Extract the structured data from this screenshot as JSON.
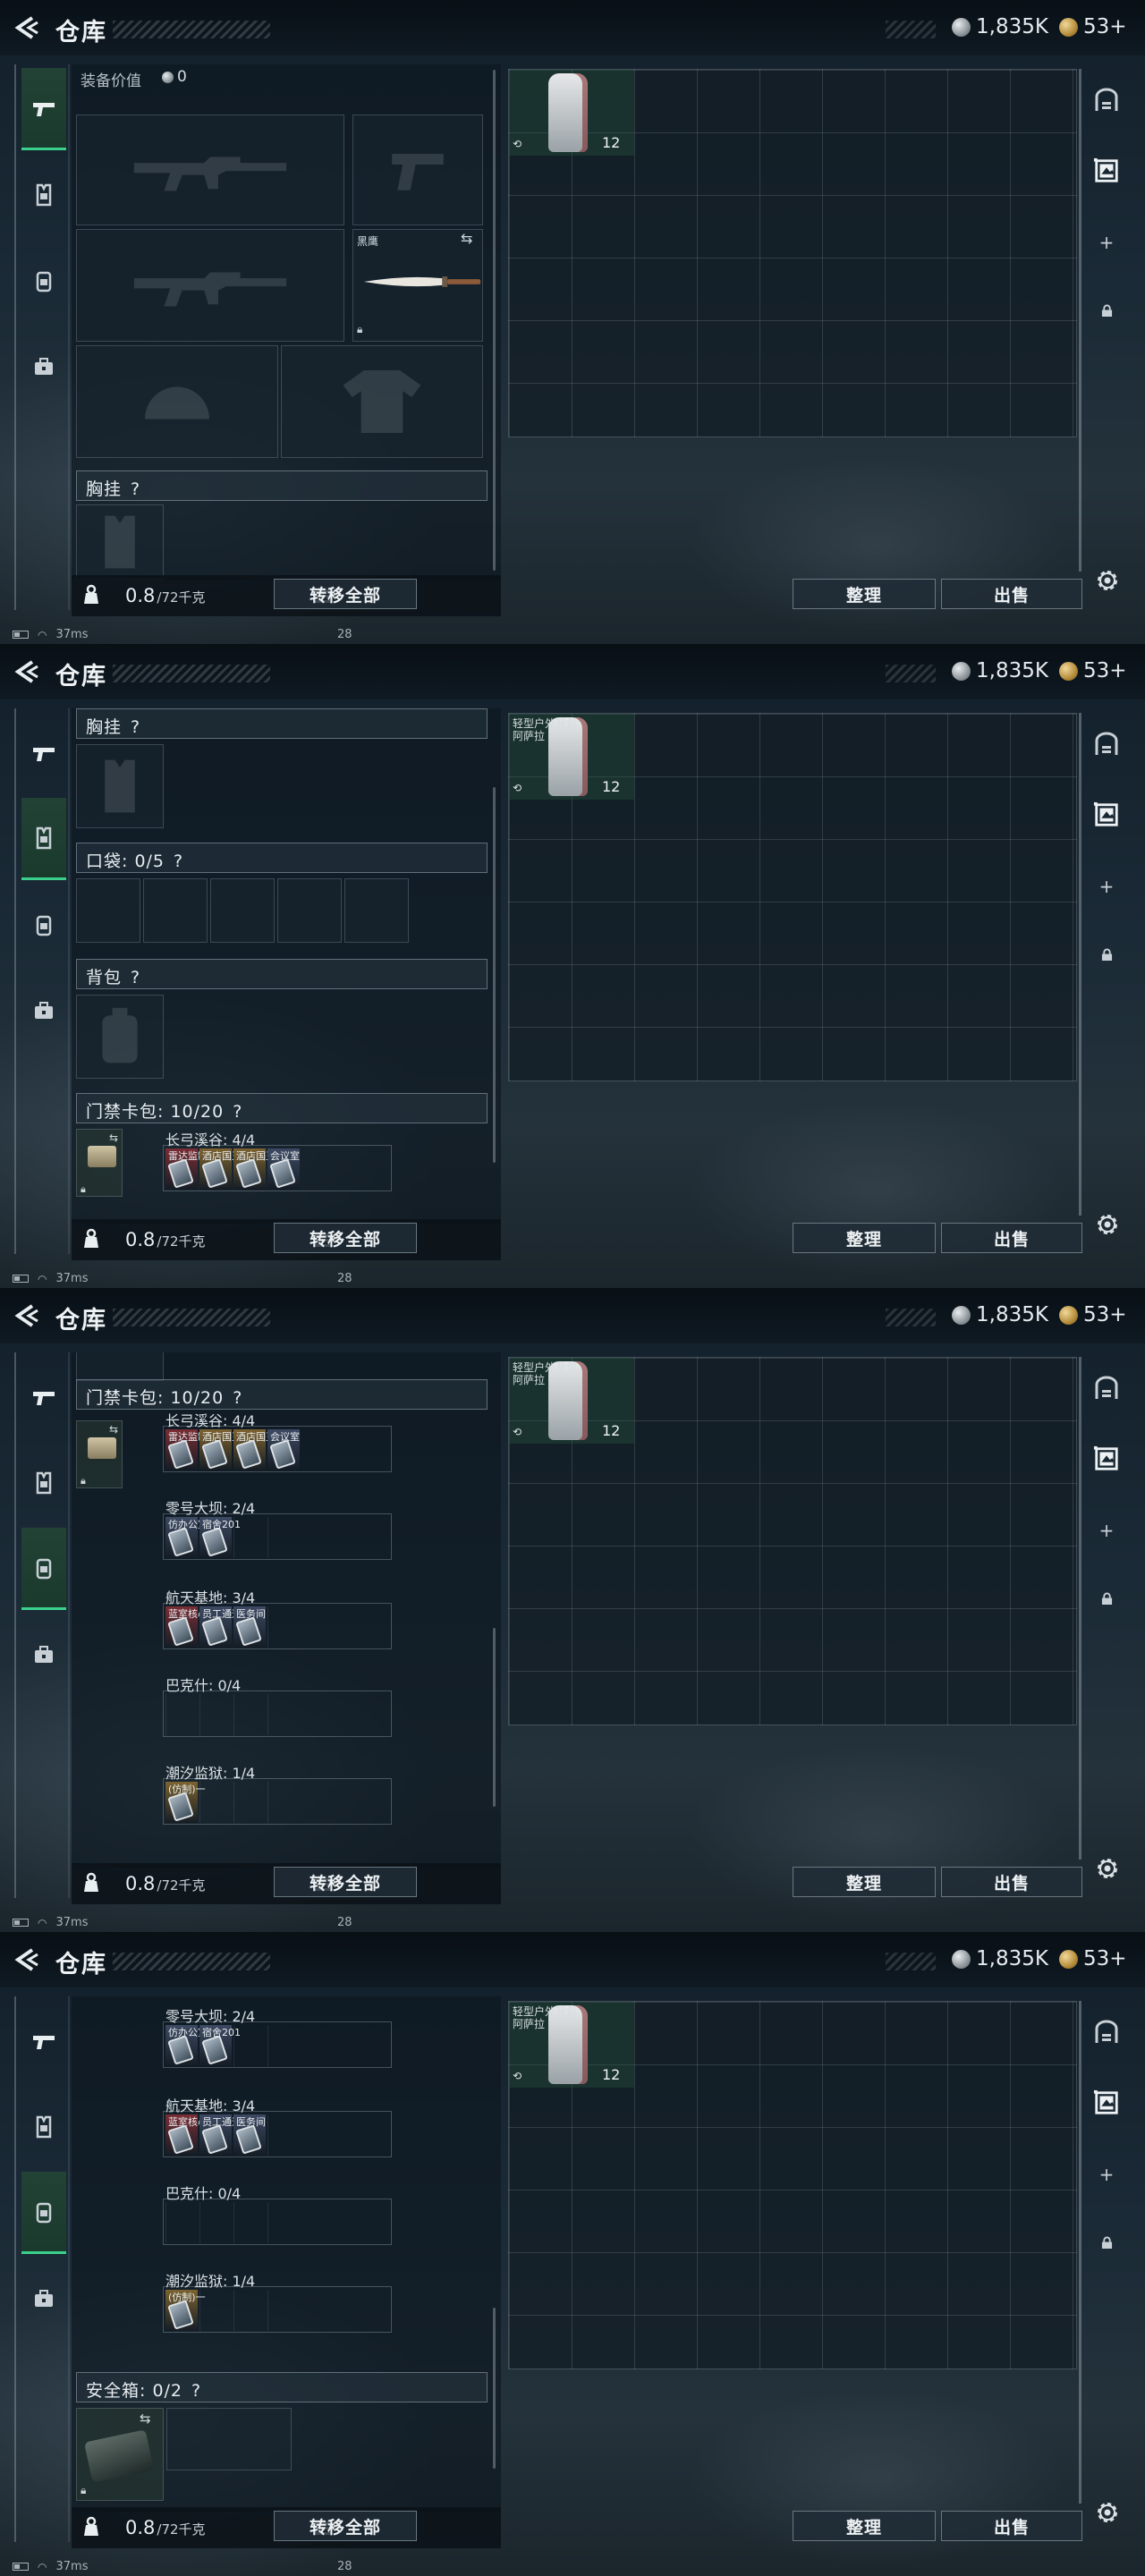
{
  "header": {
    "title": "仓库",
    "silver_value": "1,835K",
    "gold_value": "53+"
  },
  "labels": {
    "equip_value": "装备价值",
    "equip_value_amount": "0",
    "chest_rig": "胸挂",
    "pockets": "口袋: 0/5",
    "backpack": "背包",
    "keycard_pack": "门禁卡包: 10/20",
    "safe_box": "安全箱: 0/2",
    "help": "?",
    "knife_name": "黑鹰",
    "transfer_all": "转移全部",
    "sort": "整理",
    "sell": "出售",
    "weight_current": "0.8",
    "weight_max": "/72千克",
    "grid_item_name_line1": "轻型户外背包",
    "grid_item_name_line2": "阿萨拉",
    "grid_item_count": "12"
  },
  "status": {
    "ping": "37ms",
    "mid_number": "28"
  },
  "keycards": {
    "groups": [
      {
        "title": "长弓溪谷: 4/4",
        "cards": [
          {
            "label": "雷达监制室",
            "color": "#7a2e34"
          },
          {
            "label": "酒店国王房",
            "color": "#7d6330"
          },
          {
            "label": "酒店国王房",
            "color": "#7d6330"
          },
          {
            "label": "会议室",
            "color": "#3d4a63"
          }
        ]
      },
      {
        "title": "零号大坝: 2/4",
        "cards": [
          {
            "label": "仿办公室",
            "color": "#3d4a63"
          },
          {
            "label": "宿舍201",
            "color": "#3d4a63"
          }
        ]
      },
      {
        "title": "航天基地: 3/4",
        "cards": [
          {
            "label": "蓝室核心",
            "color": "#7a2e34"
          },
          {
            "label": "员工通道",
            "color": "#3d4a63"
          },
          {
            "label": "医务间",
            "color": "#3d4a63"
          }
        ]
      },
      {
        "title": "巴克什: 0/4",
        "cards": []
      },
      {
        "title": "潮汐监狱: 1/4",
        "cards": [
          {
            "label": "(仿制)一",
            "color": "#7d6330"
          }
        ]
      }
    ]
  },
  "colors": {
    "accent": "#3bd08c",
    "panel": "#0e1820"
  }
}
